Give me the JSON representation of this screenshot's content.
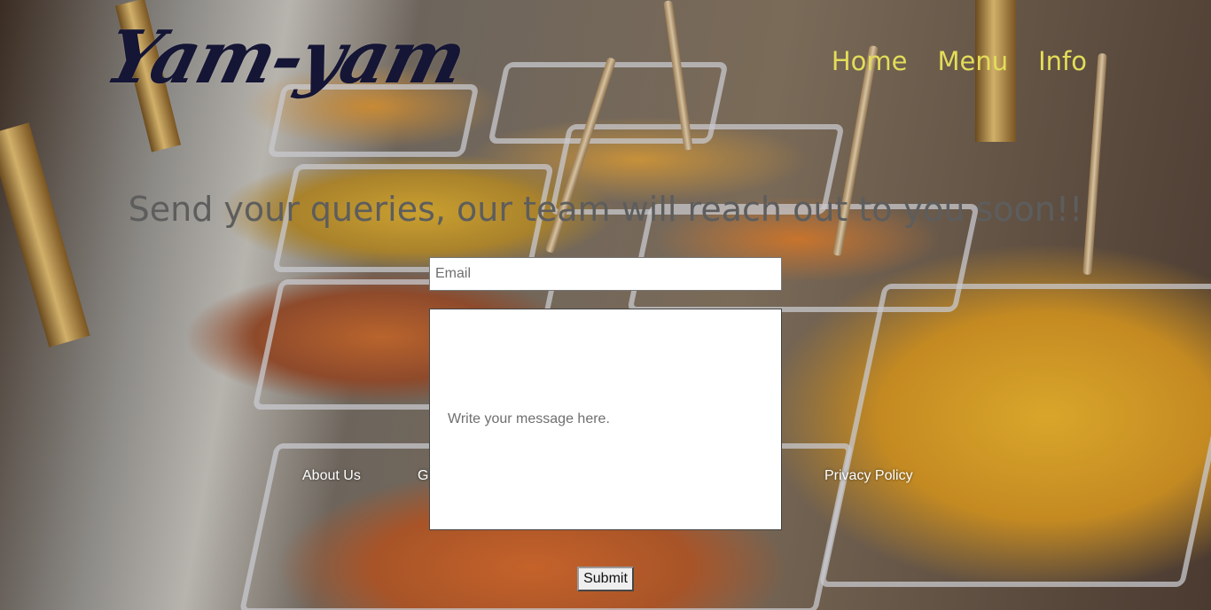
{
  "brand": {
    "logo_text": "Yam-yam"
  },
  "nav": {
    "items": [
      {
        "label": "Home"
      },
      {
        "label": "Menu"
      },
      {
        "label": "Info"
      }
    ],
    "color": "#e3dd59"
  },
  "contact": {
    "heading": "Send your queries, our team will reach out to you soon!!",
    "email_placeholder": "Email",
    "message_placeholder": "Write your message here.",
    "submit_label": "Submit"
  },
  "footer": {
    "links": [
      {
        "label": "About Us"
      },
      {
        "label": "Ga"
      },
      {
        "label": "Privacy Policy"
      }
    ]
  },
  "colors": {
    "logo": "#151535",
    "heading": "#5d5d5d"
  }
}
